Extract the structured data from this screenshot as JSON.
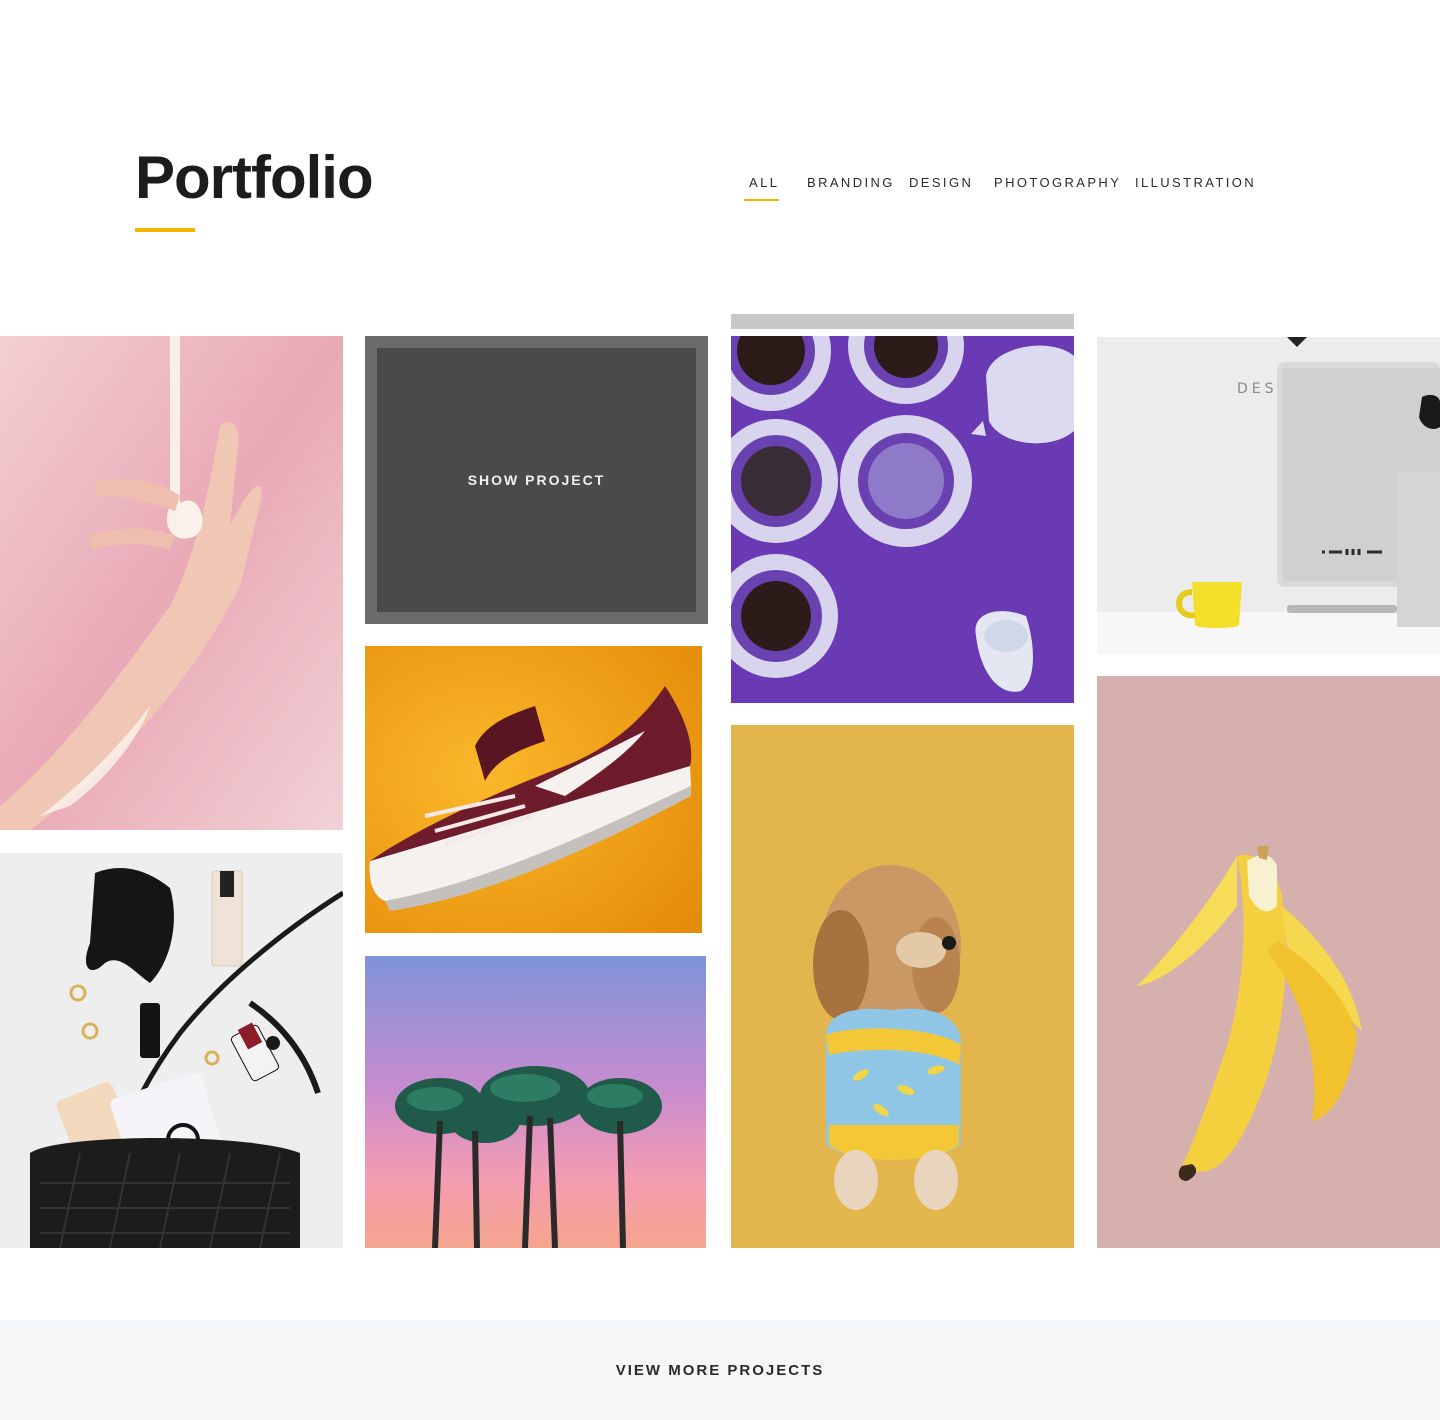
{
  "page": {
    "title": "Portfolio",
    "accent_color": "#f7b500"
  },
  "filters": [
    {
      "label": "ALL",
      "active": true
    },
    {
      "label": "BRANDING",
      "active": false
    },
    {
      "label": "DESIGN",
      "active": false
    },
    {
      "label": "PHOTOGRAPHY",
      "active": false
    },
    {
      "label": "ILLUSTRATION",
      "active": false
    }
  ],
  "grid": {
    "hover_label": "SHOW PROJECT",
    "tiles": [
      {
        "subject": "pink-hand-paint"
      },
      {
        "subject": "handbag-flatlay"
      },
      {
        "subject": "hovered-project"
      },
      {
        "subject": "sneaker-orange"
      },
      {
        "subject": "palm-trees-sunset"
      },
      {
        "subject": "purple-coffee-cups"
      },
      {
        "subject": "dog-yellow"
      },
      {
        "subject": "imac-desk"
      },
      {
        "subject": "banana-pink"
      }
    ]
  },
  "footer": {
    "button_label": "VIEW MORE PROJECTS"
  }
}
